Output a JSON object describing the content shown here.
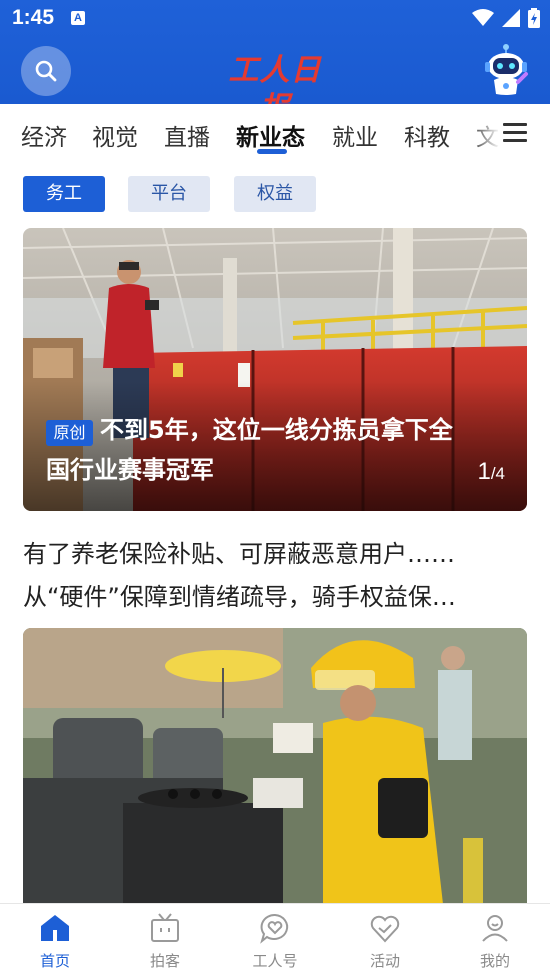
{
  "status_bar": {
    "time": "1:45",
    "notification_icon_letter": "A",
    "icons": [
      "wifi-icon",
      "signal-icon",
      "battery-icon"
    ]
  },
  "app_bar": {
    "search_icon": "search-icon",
    "logo_text": "工人日报",
    "assistant_icon": "robot-assistant-icon"
  },
  "channel_tabs": [
    {
      "label": "经济",
      "active": false
    },
    {
      "label": "视觉",
      "active": false
    },
    {
      "label": "直播",
      "active": false
    },
    {
      "label": "新业态",
      "active": true
    },
    {
      "label": "就业",
      "active": false
    },
    {
      "label": "科教",
      "active": false
    },
    {
      "label": "文",
      "active": false
    }
  ],
  "menu_icon": "hamburger-menu-icon",
  "sub_channels": [
    {
      "label": "务工",
      "active": true
    },
    {
      "label": "平台",
      "active": false
    },
    {
      "label": "权益",
      "active": false
    }
  ],
  "feature": {
    "badge": "原创",
    "title": "不到5年，这位一线分拣员拿下全国行业赛事冠军",
    "pager_current": "1",
    "pager_total": "/4"
  },
  "article": {
    "line1": "有了养老保险补贴、可屏蔽恶意用户……",
    "line2": "从“硬件”保障到情绪疏导，骑手权益保…"
  },
  "bottom_nav": [
    {
      "label": "首页",
      "icon": "home-icon",
      "active": true
    },
    {
      "label": "拍客",
      "icon": "tv-icon",
      "active": false
    },
    {
      "label": "工人号",
      "icon": "heart-chat-icon",
      "active": false
    },
    {
      "label": "活动",
      "icon": "heart-check-icon",
      "active": false
    },
    {
      "label": "我的",
      "icon": "profile-icon",
      "active": false
    }
  ],
  "colors": {
    "primary": "#1d5fd6",
    "logo_red": "#e53a30",
    "chip_inactive_bg": "#e1e7f3"
  }
}
